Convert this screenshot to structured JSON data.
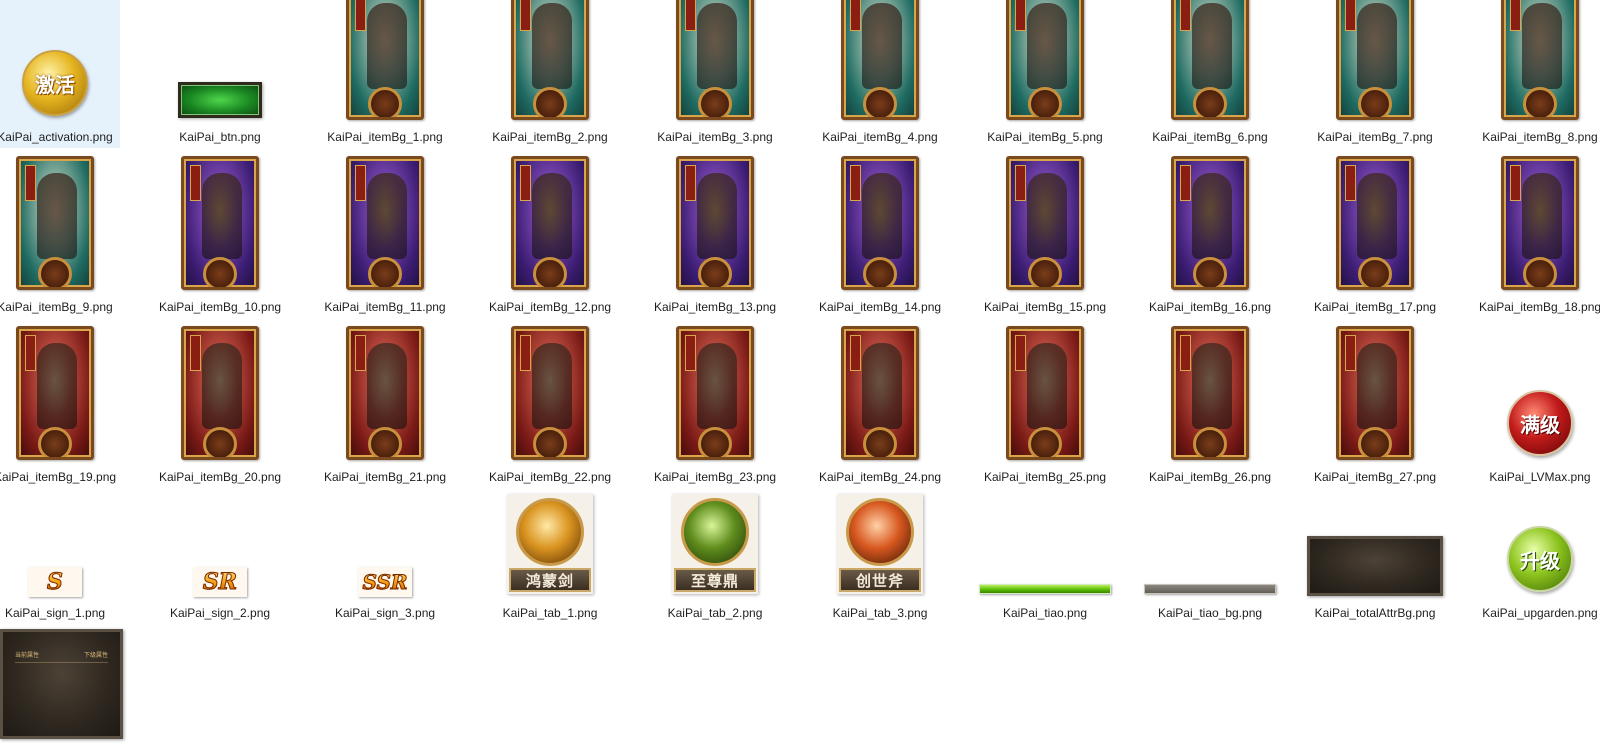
{
  "files": [
    {
      "id": "activation",
      "name": "KaiPai_activation.png",
      "kind": "orb",
      "style": "gold",
      "text": "激活",
      "selected": true
    },
    {
      "id": "btn",
      "name": "KaiPai_btn.png",
      "kind": "button"
    },
    {
      "id": "itemBg_1",
      "name": "KaiPai_itemBg_1.png",
      "kind": "card",
      "theme": "teal"
    },
    {
      "id": "itemBg_2",
      "name": "KaiPai_itemBg_2.png",
      "kind": "card",
      "theme": "teal"
    },
    {
      "id": "itemBg_3",
      "name": "KaiPai_itemBg_3.png",
      "kind": "card",
      "theme": "teal"
    },
    {
      "id": "itemBg_4",
      "name": "KaiPai_itemBg_4.png",
      "kind": "card",
      "theme": "teal"
    },
    {
      "id": "itemBg_5",
      "name": "KaiPai_itemBg_5.png",
      "kind": "card",
      "theme": "teal"
    },
    {
      "id": "itemBg_6",
      "name": "KaiPai_itemBg_6.png",
      "kind": "card",
      "theme": "teal"
    },
    {
      "id": "itemBg_7",
      "name": "KaiPai_itemBg_7.png",
      "kind": "card",
      "theme": "teal"
    },
    {
      "id": "itemBg_8",
      "name": "KaiPai_itemBg_8.png",
      "kind": "card",
      "theme": "teal"
    },
    {
      "id": "itemBg_9",
      "name": "KaiPai_itemBg_9.png",
      "kind": "card",
      "theme": "teal"
    },
    {
      "id": "itemBg_10",
      "name": "KaiPai_itemBg_10.png",
      "kind": "card",
      "theme": "purple"
    },
    {
      "id": "itemBg_11",
      "name": "KaiPai_itemBg_11.png",
      "kind": "card",
      "theme": "purple"
    },
    {
      "id": "itemBg_12",
      "name": "KaiPai_itemBg_12.png",
      "kind": "card",
      "theme": "purple"
    },
    {
      "id": "itemBg_13",
      "name": "KaiPai_itemBg_13.png",
      "kind": "card",
      "theme": "purple"
    },
    {
      "id": "itemBg_14",
      "name": "KaiPai_itemBg_14.png",
      "kind": "card",
      "theme": "purple"
    },
    {
      "id": "itemBg_15",
      "name": "KaiPai_itemBg_15.png",
      "kind": "card",
      "theme": "purple"
    },
    {
      "id": "itemBg_16",
      "name": "KaiPai_itemBg_16.png",
      "kind": "card",
      "theme": "purple"
    },
    {
      "id": "itemBg_17",
      "name": "KaiPai_itemBg_17.png",
      "kind": "card",
      "theme": "purple"
    },
    {
      "id": "itemBg_18",
      "name": "KaiPai_itemBg_18.png",
      "kind": "card",
      "theme": "purple"
    },
    {
      "id": "itemBg_19",
      "name": "KaiPai_itemBg_19.png",
      "kind": "card",
      "theme": "red"
    },
    {
      "id": "itemBg_20",
      "name": "KaiPai_itemBg_20.png",
      "kind": "card",
      "theme": "red"
    },
    {
      "id": "itemBg_21",
      "name": "KaiPai_itemBg_21.png",
      "kind": "card",
      "theme": "red"
    },
    {
      "id": "itemBg_22",
      "name": "KaiPai_itemBg_22.png",
      "kind": "card",
      "theme": "red"
    },
    {
      "id": "itemBg_23",
      "name": "KaiPai_itemBg_23.png",
      "kind": "card",
      "theme": "red"
    },
    {
      "id": "itemBg_24",
      "name": "KaiPai_itemBg_24.png",
      "kind": "card",
      "theme": "red"
    },
    {
      "id": "itemBg_25",
      "name": "KaiPai_itemBg_25.png",
      "kind": "card",
      "theme": "red"
    },
    {
      "id": "itemBg_26",
      "name": "KaiPai_itemBg_26.png",
      "kind": "card",
      "theme": "red"
    },
    {
      "id": "itemBg_27",
      "name": "KaiPai_itemBg_27.png",
      "kind": "card",
      "theme": "red"
    },
    {
      "id": "LVMax",
      "name": "KaiPai_LVMax.png",
      "kind": "orb",
      "style": "red",
      "text": "满级"
    },
    {
      "id": "sign_1",
      "name": "KaiPai_sign_1.png",
      "kind": "sign",
      "text": "S"
    },
    {
      "id": "sign_2",
      "name": "KaiPai_sign_2.png",
      "kind": "sign",
      "text": "SR"
    },
    {
      "id": "sign_3",
      "name": "KaiPai_sign_3.png",
      "kind": "sign",
      "text": "SSR"
    },
    {
      "id": "tab_1",
      "name": "KaiPai_tab_1.png",
      "kind": "tab",
      "text": "鸿蒙剑"
    },
    {
      "id": "tab_2",
      "name": "KaiPai_tab_2.png",
      "kind": "tab",
      "text": "至尊鼎"
    },
    {
      "id": "tab_3",
      "name": "KaiPai_tab_3.png",
      "kind": "tab",
      "text": "创世斧"
    },
    {
      "id": "tiao",
      "name": "KaiPai_tiao.png",
      "kind": "bar",
      "style": "green"
    },
    {
      "id": "tiao_bg",
      "name": "KaiPai_tiao_bg.png",
      "kind": "bar",
      "style": "grey"
    },
    {
      "id": "totalAttrBg",
      "name": "KaiPai_totalAttrBg.png",
      "kind": "panel"
    },
    {
      "id": "upgarden",
      "name": "KaiPai_upgarden.png",
      "kind": "orb",
      "style": "green",
      "text": "升级"
    },
    {
      "id": "panel2",
      "name": "",
      "kind": "panel",
      "text_left": "当前属性",
      "text_right": "下级属性"
    }
  ]
}
